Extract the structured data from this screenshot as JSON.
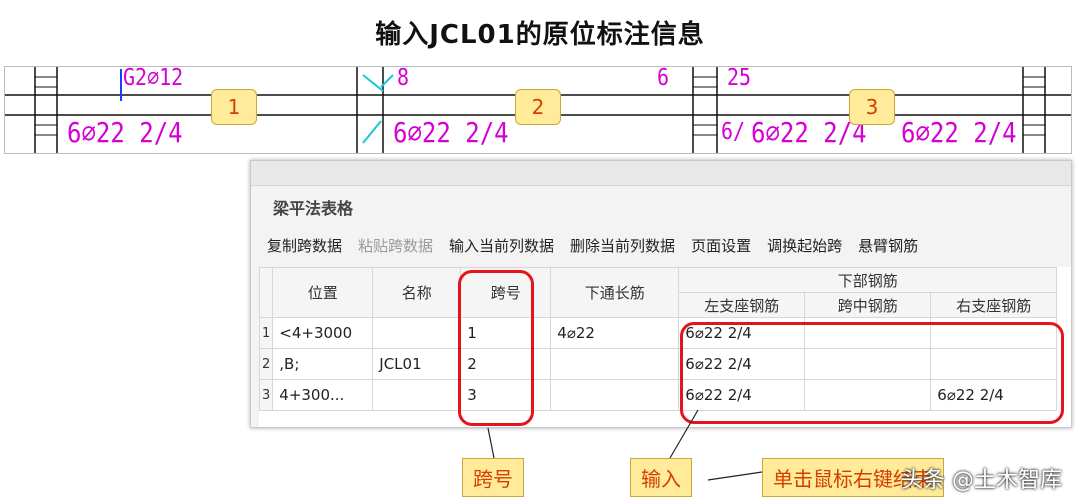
{
  "title": "输入JCL01的原位标注信息",
  "cad": {
    "top_texts": [
      "G2⌀12",
      "8",
      "6",
      "25"
    ],
    "bottom_texts": [
      "6⌀22 2/4",
      "6⌀22 2/4",
      "6⌀22 2/4",
      "6⌀22 2/4",
      "6/"
    ],
    "span_labels": [
      "1",
      "2",
      "3"
    ],
    "line_color": "#d400d4"
  },
  "panel": {
    "title": "梁平法表格",
    "toolbar": [
      "复制跨数据",
      "粘贴跨数据",
      "输入当前列数据",
      "删除当前列数据",
      "页面设置",
      "调换起始跨",
      "悬臂钢筋"
    ],
    "headers": {
      "position": "位置",
      "name": "名称",
      "span": "跨号",
      "bottom_through": "下通长筋",
      "bottom_group": "下部钢筋",
      "left_support": "左支座钢筋",
      "mid_span": "跨中钢筋",
      "right_support": "右支座钢筋"
    },
    "rows": [
      {
        "num": "1",
        "position": "<4+3000",
        "name": "",
        "span": "1",
        "bottom_through": "4⌀22",
        "left_support": "6⌀22 2/4",
        "mid_span": "",
        "right_support": ""
      },
      {
        "num": "2",
        "position": ",B;",
        "name": "JCL01",
        "span": "2",
        "bottom_through": "",
        "left_support": "6⌀22 2/4",
        "mid_span": "",
        "right_support": ""
      },
      {
        "num": "3",
        "position": "4+300...",
        "name": "",
        "span": "3",
        "bottom_through": "",
        "left_support": "6⌀22 2/4",
        "mid_span": "",
        "right_support": "6⌀22 2/4"
      }
    ]
  },
  "callouts": {
    "span": "跨号",
    "input": "输入",
    "click": "单击鼠标右键结束"
  },
  "watermark": "头条 @土木智库",
  "colors": {
    "annotation_red": "#e5141b",
    "callout_bg": "#ffeb99",
    "callout_text": "#d43f00",
    "cad_magenta": "#d400d4"
  }
}
